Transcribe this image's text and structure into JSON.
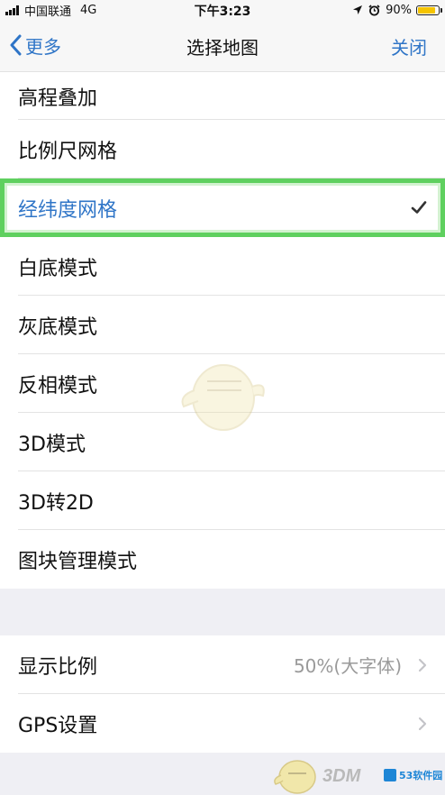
{
  "status_bar": {
    "carrier": "中国联通",
    "network": "4G",
    "time": "下午3:23",
    "battery": "90%",
    "battery_level": 0.9,
    "battery_color": "#f5c400"
  },
  "nav": {
    "back_label": "更多",
    "title": "选择地图",
    "close_label": "关闭",
    "accent_color": "#2f75c7"
  },
  "map_modes": {
    "items": [
      {
        "label": "高程叠加",
        "selected": false
      },
      {
        "label": "比例尺网格",
        "selected": false
      },
      {
        "label": "经纬度网格",
        "selected": true
      },
      {
        "label": "白底模式",
        "selected": false
      },
      {
        "label": "灰底模式",
        "selected": false
      },
      {
        "label": "反相模式",
        "selected": false
      },
      {
        "label": "3D模式",
        "selected": false
      },
      {
        "label": "3D转2D",
        "selected": false
      },
      {
        "label": "图块管理模式",
        "selected": false
      }
    ],
    "checkmark_icon": "checkmark-icon",
    "highlight_color": "#5fd05f"
  },
  "settings": {
    "items": [
      {
        "label": "显示比例",
        "value": "50%(大字体)",
        "icon": "chevron-right-icon"
      },
      {
        "label": "GPS设置",
        "value": "",
        "icon": "chevron-right-icon"
      }
    ]
  },
  "watermark": {
    "brand": "3DM",
    "site": "53软件园"
  }
}
